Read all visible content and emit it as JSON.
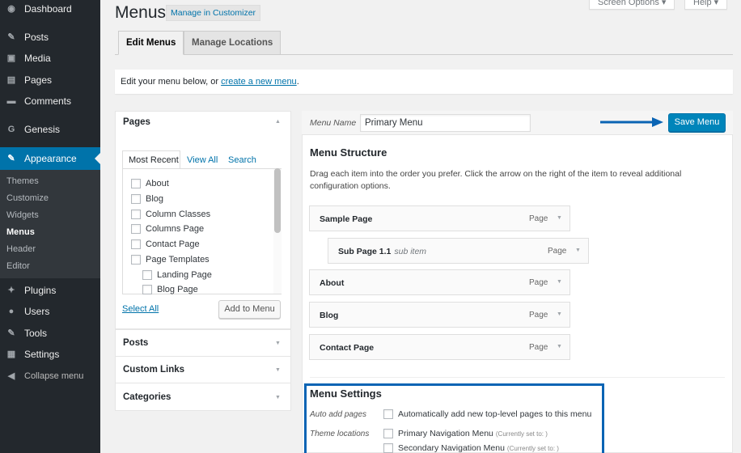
{
  "sidebar": {
    "items": [
      {
        "label": "Dashboard",
        "icon": "dashboard-icon",
        "glyph": "◉"
      },
      {
        "label": "Posts",
        "icon": "pin-icon",
        "glyph": "✎"
      },
      {
        "label": "Media",
        "icon": "media-icon",
        "glyph": "▣"
      },
      {
        "label": "Pages",
        "icon": "pages-icon",
        "glyph": "▤"
      },
      {
        "label": "Comments",
        "icon": "comments-icon",
        "glyph": "▬"
      },
      {
        "label": "Genesis",
        "icon": "genesis-icon",
        "glyph": "G"
      },
      {
        "label": "Appearance",
        "icon": "appearance-icon",
        "glyph": "✎"
      },
      {
        "label": "Plugins",
        "icon": "plugins-icon",
        "glyph": "✦"
      },
      {
        "label": "Users",
        "icon": "users-icon",
        "glyph": "●"
      },
      {
        "label": "Tools",
        "icon": "tools-icon",
        "glyph": "✎"
      },
      {
        "label": "Settings",
        "icon": "settings-icon",
        "glyph": "▦"
      },
      {
        "label": "Collapse menu",
        "icon": "collapse-icon",
        "glyph": "◀"
      }
    ],
    "submenu": [
      "Themes",
      "Customize",
      "Widgets",
      "Menus",
      "Header",
      "Editor"
    ]
  },
  "header": {
    "title": "Menus",
    "customizer_label": "Manage in Customizer",
    "screen_options": "Screen Options ▾",
    "help": "Help ▾"
  },
  "tabs": [
    "Edit Menus",
    "Manage Locations"
  ],
  "notice": {
    "text": "Edit your menu below, or ",
    "link": "create a new menu",
    "suffix": "."
  },
  "left": {
    "pages_title": "Pages",
    "inner_tabs": [
      "Most Recent",
      "View All",
      "Search"
    ],
    "pages": [
      "About",
      "Blog",
      "Column Classes",
      "Columns Page",
      "Contact Page",
      "Page Templates",
      "Landing Page",
      "Blog Page"
    ],
    "select_all": "Select All",
    "add_to_menu": "Add to Menu",
    "sections": [
      "Posts",
      "Custom Links",
      "Categories"
    ]
  },
  "right": {
    "menu_name_label": "Menu Name",
    "menu_name_value": "Primary Menu",
    "save_label": "Save Menu",
    "structure_title": "Menu Structure",
    "structure_desc": "Drag each item into the order you prefer. Click the arrow on the right of the item to reveal additional configuration options.",
    "items": [
      {
        "title": "Sample Page",
        "sub": "",
        "type": "Page"
      },
      {
        "title": "Sub Page 1.1",
        "sub": "sub item",
        "type": "Page"
      },
      {
        "title": "About",
        "sub": "",
        "type": "Page"
      },
      {
        "title": "Blog",
        "sub": "",
        "type": "Page"
      },
      {
        "title": "Contact Page",
        "sub": "",
        "type": "Page"
      }
    ],
    "settings_title": "Menu Settings",
    "auto_add_label": "Auto add pages",
    "auto_add_text": "Automatically add new top-level pages to this menu",
    "theme_locations_label": "Theme locations",
    "locations": [
      {
        "name": "Primary Navigation Menu",
        "note": "(Currently set to: )"
      },
      {
        "name": "Secondary Navigation Menu",
        "note": "(Currently set to: )"
      }
    ]
  },
  "colors": {
    "sidebar_bg": "#23282d",
    "accent": "#0073aa",
    "highlight_box": "#0a64b4"
  }
}
